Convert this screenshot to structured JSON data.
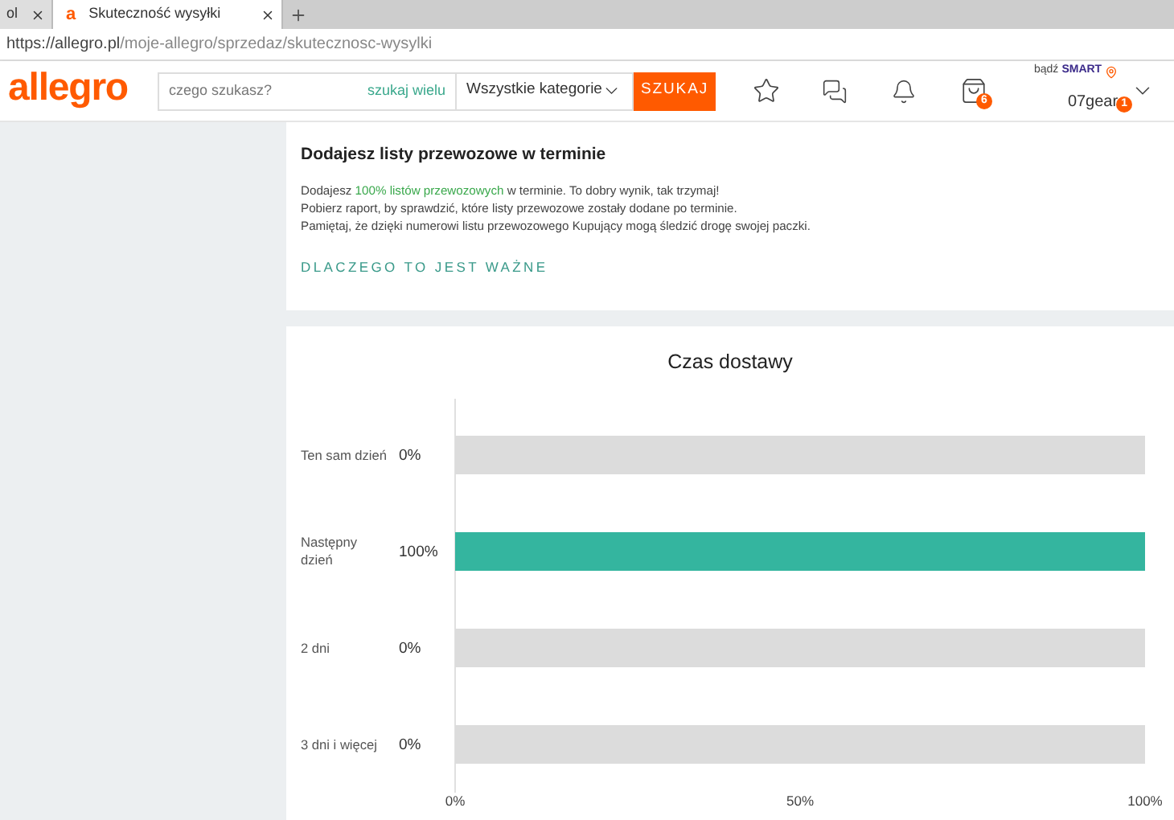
{
  "browser": {
    "tabs": [
      {
        "title": "ol",
        "selected": false
      },
      {
        "title": "Skuteczność wysyłki",
        "favicon": "a",
        "selected": true
      }
    ],
    "url_host": "https://allegro.pl",
    "url_path": "/moje-allegro/sprzedaz/skutecznosc-wysylki"
  },
  "header": {
    "logo": "allegro",
    "search": {
      "placeholder": "czego szukasz?",
      "multi_link": "szukaj wielu",
      "category": "Wszystkie kategorie",
      "button": "SZUKAJ"
    },
    "cart_badge": "6",
    "smart_prefix": "bądź",
    "smart_label": "SMART",
    "user": "07gear",
    "user_badge": "1"
  },
  "info": {
    "title": "Dodajesz listy przewozowe w terminie",
    "first_line": {
      "before": "Dodajesz ",
      "highlight": "100% listów przewozowych",
      "after": " w terminie. To dobry wynik, tak trzymaj!"
    },
    "lines": [
      "Pobierz raport, by sprawdzić, które listy przewozowe zostały dodane po terminie.",
      "Pamiętaj, że dzięki numerowi listu przewozowego Kupujący mogą śledzić drogę swojej paczki."
    ],
    "link": "DLACZEGO TO JEST WAŻNE"
  },
  "chart_data": {
    "type": "bar",
    "orientation": "horizontal",
    "title": "Czas dostawy",
    "categories": [
      "Ten sam dzień",
      "Następny dzień",
      "2 dni",
      "3 dni i więcej"
    ],
    "stacked": true,
    "series": [
      {
        "color": "#34b59f",
        "values": [
          0,
          100,
          0,
          0
        ]
      },
      {
        "color": "#dcdcdc",
        "values": [
          100,
          0,
          100,
          100
        ]
      }
    ],
    "value_labels": [
      "0%",
      "100%",
      "0%",
      "0%"
    ],
    "xlim": [
      0,
      100
    ],
    "xticks": [
      {
        "value": 0,
        "label": "0%"
      },
      {
        "value": 50,
        "label": "50%"
      },
      {
        "value": 100,
        "label": "100%"
      }
    ]
  }
}
